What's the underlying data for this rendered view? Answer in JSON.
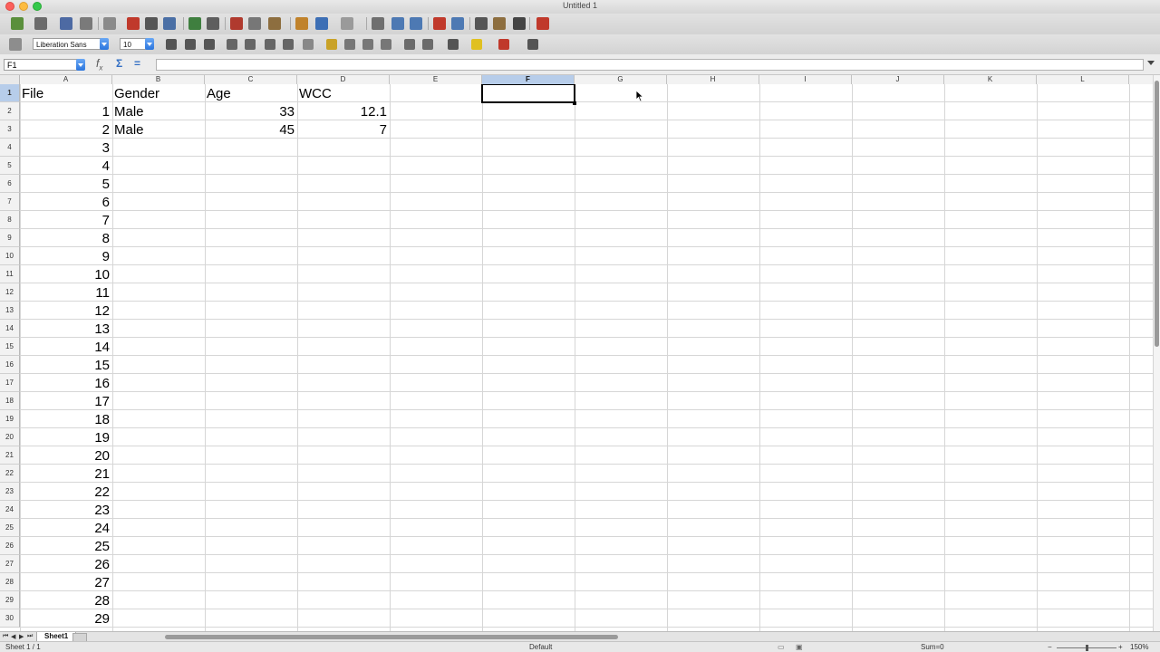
{
  "window": {
    "title": "Untitled 1"
  },
  "toolbar": {
    "font_name": "Liberation Sans",
    "font_size": "10",
    "icons": [
      "new-icon",
      "open-icon",
      "save-icon",
      "email-icon",
      "edit-file-icon",
      "pdf-icon",
      "print-icon",
      "print-preview-icon",
      "spellcheck-icon",
      "autospell-icon",
      "cut-icon",
      "copy-icon",
      "paste-icon",
      "clone-format-icon",
      "undo-icon",
      "redo-icon",
      "hyperlink-icon",
      "sort-ascending-icon",
      "sort-descending-icon",
      "chart-icon",
      "pivot-table-icon",
      "navigator-icon",
      "gallery-icon",
      "datasources-icon",
      "help-icon"
    ],
    "format_icons": [
      "bold-icon",
      "italic-icon",
      "underline-icon",
      "align-left-icon",
      "align-center-icon",
      "align-right-icon",
      "justify-icon",
      "merge-icon",
      "currency-icon",
      "percent-icon",
      "add-decimal-icon",
      "remove-decimal-icon",
      "decrease-indent-icon",
      "increase-indent-icon",
      "borders-icon",
      "background-color-icon",
      "font-color-icon",
      "sidebar-icon"
    ]
  },
  "formula_bar": {
    "name_box": "F1",
    "formula": ""
  },
  "grid": {
    "columns": [
      "A",
      "B",
      "C",
      "D",
      "E",
      "F",
      "G",
      "H",
      "I",
      "J",
      "K",
      "L"
    ],
    "active_column": "F",
    "active_row": 1,
    "rows": [
      "1",
      "2",
      "3",
      "4",
      "5",
      "6",
      "7",
      "8",
      "9",
      "10",
      "11",
      "12",
      "13",
      "14",
      "15",
      "16",
      "17",
      "18",
      "19",
      "20",
      "21",
      "22",
      "23",
      "24",
      "25",
      "26",
      "27",
      "28",
      "29",
      "30"
    ],
    "data": [
      [
        "File",
        "Gender",
        "Age",
        "WCC"
      ],
      [
        "1",
        "Male",
        "33",
        "12.1"
      ],
      [
        "2",
        "Male",
        "45",
        "7"
      ],
      [
        "3",
        "",
        "",
        ""
      ],
      [
        "4",
        "",
        "",
        ""
      ],
      [
        "5",
        "",
        "",
        ""
      ],
      [
        "6",
        "",
        "",
        ""
      ],
      [
        "7",
        "",
        "",
        ""
      ],
      [
        "8",
        "",
        "",
        ""
      ],
      [
        "9",
        "",
        "",
        ""
      ],
      [
        "10",
        "",
        "",
        ""
      ],
      [
        "11",
        "",
        "",
        ""
      ],
      [
        "12",
        "",
        "",
        ""
      ],
      [
        "13",
        "",
        "",
        ""
      ],
      [
        "14",
        "",
        "",
        ""
      ],
      [
        "15",
        "",
        "",
        ""
      ],
      [
        "16",
        "",
        "",
        ""
      ],
      [
        "17",
        "",
        "",
        ""
      ],
      [
        "18",
        "",
        "",
        ""
      ],
      [
        "19",
        "",
        "",
        ""
      ],
      [
        "20",
        "",
        "",
        ""
      ],
      [
        "21",
        "",
        "",
        ""
      ],
      [
        "22",
        "",
        "",
        ""
      ],
      [
        "23",
        "",
        "",
        ""
      ],
      [
        "24",
        "",
        "",
        ""
      ],
      [
        "25",
        "",
        "",
        ""
      ],
      [
        "26",
        "",
        "",
        ""
      ],
      [
        "27",
        "",
        "",
        ""
      ],
      [
        "28",
        "",
        "",
        ""
      ],
      [
        "29",
        "",
        "",
        ""
      ]
    ]
  },
  "tabs": {
    "sheets": [
      "Sheet1"
    ]
  },
  "status": {
    "sheet": "Sheet 1 / 1",
    "style": "Default",
    "sum": "Sum=0",
    "zoom": "150%",
    "zoom_minus": "−",
    "zoom_plus": "+"
  },
  "colors": {
    "selection_header": "#b7cdea",
    "accent": "#2b75dd"
  }
}
